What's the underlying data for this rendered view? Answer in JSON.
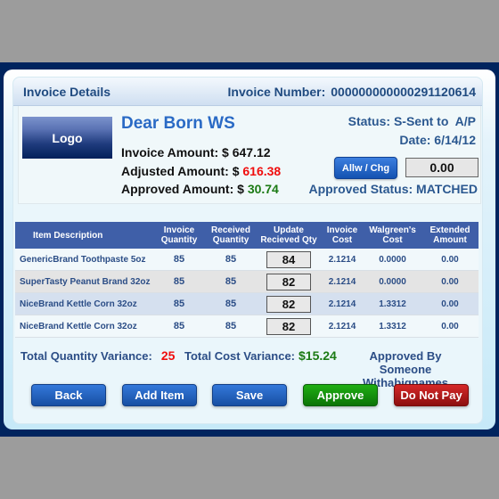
{
  "header": {
    "title": "Invoice Details",
    "invoice_number_label": "Invoice Number:",
    "invoice_number": "000000000000291120614"
  },
  "vendor": {
    "logo_label": "Logo",
    "name": "Dear Born WS",
    "invoice_amount_label": "Invoice Amount: $",
    "invoice_amount": "647.12",
    "adjusted_amount_label": "Adjusted Amount: $",
    "adjusted_amount": "616.38",
    "approved_amount_label": "Approved Amount: $",
    "approved_amount": "30.74"
  },
  "status": {
    "status_text": "Status: S-Sent to  A/P",
    "date_text": "Date: 6/14/12",
    "allw_chg_label": "Allw / Chg",
    "allw_chg_value": "0.00",
    "approved_status_text": "Approved Status: MATCHED"
  },
  "table": {
    "headers": {
      "item": "Item Description",
      "invoice_qty_1": "Invoice",
      "invoice_qty_2": "Quantity",
      "received_qty_1": "Received",
      "received_qty_2": "Quantity",
      "update_qty_1": "Update",
      "update_qty_2": "Recieved Qty",
      "invoice_cost_1": "Invoice",
      "invoice_cost_2": "Cost",
      "wag_cost_1": "Walgreen's",
      "wag_cost_2": "Cost",
      "extended_1": "Extended",
      "extended_2": "Amount"
    },
    "rows": [
      {
        "item": "GenericBrand Toothpaste 5oz",
        "invoice_qty": "85",
        "received_qty": "85",
        "update_qty": "84",
        "invoice_cost": "2.1214",
        "wag_cost": "0.0000",
        "extended": "0.00"
      },
      {
        "item": "SuperTasty Peanut Brand 32oz",
        "invoice_qty": "85",
        "received_qty": "85",
        "update_qty": "82",
        "invoice_cost": "2.1214",
        "wag_cost": "0.0000",
        "extended": "0.00"
      },
      {
        "item": "NiceBrand Kettle Corn 32oz",
        "invoice_qty": "85",
        "received_qty": "85",
        "update_qty": "82",
        "invoice_cost": "2.1214",
        "wag_cost": "1.3312",
        "extended": "0.00"
      },
      {
        "item": "NiceBrand Kettle Corn 32oz",
        "invoice_qty": "85",
        "received_qty": "85",
        "update_qty": "82",
        "invoice_cost": "2.1214",
        "wag_cost": "1.3312",
        "extended": "0.00"
      }
    ]
  },
  "totals": {
    "qty_variance_label": "Total Quantity Variance:",
    "qty_variance": "25",
    "cost_variance_label": "Total Cost Variance:",
    "cost_variance": "$15.24",
    "approved_by_label": "Approved By",
    "approved_by_name": "Someone Withabignames"
  },
  "buttons": {
    "back": "Back",
    "add_item": "Add Item",
    "save": "Save",
    "approve": "Approve",
    "do_not_pay": "Do Not Pay"
  },
  "colors": {
    "frame": "#00245e",
    "accent_blue": "#2a6ac5",
    "table_header": "#3f5fa8",
    "negative_red": "#f00d0d",
    "positive_green": "#1b7a14"
  }
}
